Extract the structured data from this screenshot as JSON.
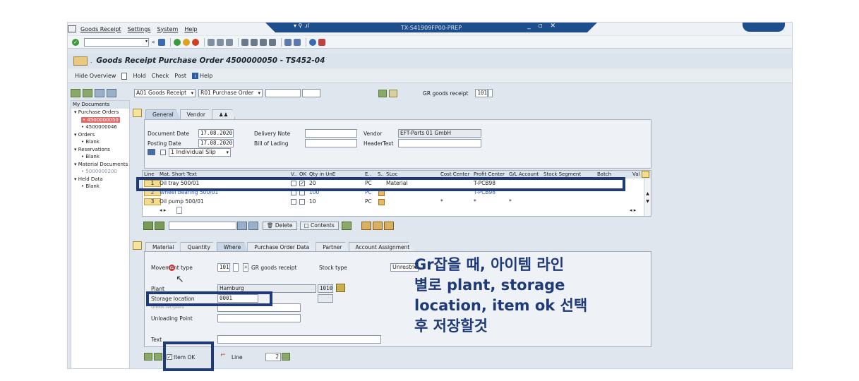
{
  "menu": {
    "items": [
      "Goods Receipt",
      "Settings",
      "System",
      "Help"
    ]
  },
  "window": {
    "system_id": "TX-S41909FP00-PREP"
  },
  "page": {
    "title": "Goods Receipt Purchase Order 4500000050 - TS452-04"
  },
  "app_toolbar": {
    "hide_overview": "Hide Overview",
    "hold": "Hold",
    "check": "Check",
    "post": "Post",
    "help": "Help"
  },
  "tree": {
    "header": "My Documents",
    "nodes": [
      {
        "label": "▾ Purchase Orders",
        "level": 1
      },
      {
        "label": "• 4500000050",
        "level": 2,
        "selected": true
      },
      {
        "label": "• 4500000046",
        "level": 2
      },
      {
        "label": "▾ Orders",
        "level": 1
      },
      {
        "label": "• Blank",
        "level": 2
      },
      {
        "label": "▾ Reservations",
        "level": 1
      },
      {
        "label": "• Blank",
        "level": 2
      },
      {
        "label": "▾ Material Documents",
        "level": 1
      },
      {
        "label": "• 5000000200",
        "level": 2,
        "grey": true
      },
      {
        "label": "▾ Held Data",
        "level": 1
      },
      {
        "label": "• Blank",
        "level": 2
      }
    ]
  },
  "selection": {
    "action": "A01 Goods Receipt",
    "reference": "R01 Purchase Order",
    "gr_label": "GR goods receipt",
    "gr_value": "101"
  },
  "header_tabs": [
    "General",
    "Vendor"
  ],
  "header": {
    "document_date_label": "Document Date",
    "document_date": "17.08.2020",
    "posting_date_label": "Posting Date",
    "posting_date": "17.08.2020",
    "delivery_note_label": "Delivery Note",
    "bill_of_lading_label": "Bill of Lading",
    "vendor_label": "Vendor",
    "vendor": "EFT-Parts 01 GmbH",
    "header_text_label": "HeaderText",
    "slip": "1 Individual Slip"
  },
  "items": {
    "columns": [
      "Line",
      "Mat. Short Text",
      "V..",
      "OK",
      "Qty in UnE",
      "E..",
      "S..",
      "SLoc",
      "Cost Center",
      "Profit Center",
      "G/L Account",
      "Stock Segment",
      "Batch",
      "Val"
    ],
    "rows": [
      {
        "line": "1",
        "text": "Oil tray 500/01",
        "ok": "✓",
        "qty": "20",
        "unit": "PC",
        "sloc": "Material",
        "profit": "T-PCB98",
        "gl": "",
        "blue": false
      },
      {
        "line": "2",
        "text": "Wheel bearing 500/01",
        "ok": "",
        "qty": "100",
        "unit": "PC",
        "sloc": "",
        "profit": "T-PCB98",
        "gl": "",
        "blue": true
      },
      {
        "line": "3",
        "text": "Oil pump 500/01",
        "ok": "",
        "qty": "10",
        "unit": "PC",
        "sloc": "",
        "profit": "*",
        "gl": "*",
        "blue": false
      }
    ]
  },
  "item_toolbar": {
    "delete": "Delete",
    "contents": "Contents"
  },
  "detail_tabs": [
    "Material",
    "Quantity",
    "Where",
    "Purchase Order Data",
    "Partner",
    "Account Assignment"
  ],
  "detail": {
    "movement_type_label": "Movement type",
    "movement_type": "101",
    "movement_plus": "+",
    "movement_text": "GR goods receipt",
    "stock_type_label": "Stock type",
    "stock_type": "Unrestric",
    "plant_label": "Plant",
    "plant": "Hamburg",
    "plant_code": "1010",
    "storage_location_label": "Storage location",
    "storage_location": "0001",
    "goods_recipient_label": "Goods recipient",
    "unloading_point_label": "Unloading Point",
    "text_label": "Text"
  },
  "bottom": {
    "item_ok": "Item OK",
    "line_label": "Line",
    "line_value": "2"
  },
  "annotation": {
    "text": "Gr잡을 때, 아이템 라인\n별로 plant, storage\nlocation, item ok 선택\n후 저장할것"
  },
  "colors": {
    "highlight": "#1f3a78",
    "title_bar": "#1f4e8c",
    "selected_tree": "#e46a6a"
  }
}
